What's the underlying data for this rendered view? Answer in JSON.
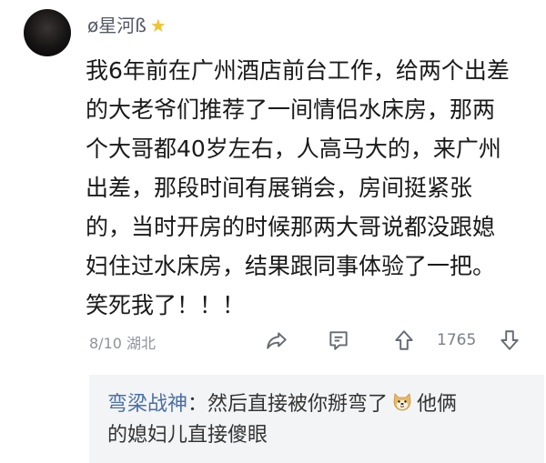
{
  "comment": {
    "username": "ø星河ß",
    "body_lines": [
      "我6年前在广州酒店前台工作，给两个出差",
      "的大老爷们推荐了一间情侣水床房，那两",
      "个大哥都40岁左右，人高马大的，来广州",
      "出差，那段时间有展销会，房间挺紧张",
      "的，当时开房的时候那两大哥说都没跟媳",
      "妇住过水床房，结果跟同事体验了一把。",
      "笑死我了！！！"
    ],
    "date_location": "8/10 湖北",
    "like_count": "1765"
  },
  "reply": {
    "author": "弯梁战神",
    "separator": "：",
    "text_before_emoji": "然后直接被你掰弯了",
    "text_after_emoji": "他俩",
    "text_line2": "的媳妇儿直接傻眼"
  },
  "icons": {
    "badge": "star-icon",
    "share": "share-icon",
    "reply": "comment-icon",
    "like": "thumbs-up-arrow-icon",
    "dislike": "thumbs-down-arrow-icon",
    "emoji": "doge-emoji-icon"
  },
  "colors": {
    "reply_author": "#4a6fa5",
    "meta_gray": "#8e939c",
    "reply_bg": "#f3f4f6"
  }
}
